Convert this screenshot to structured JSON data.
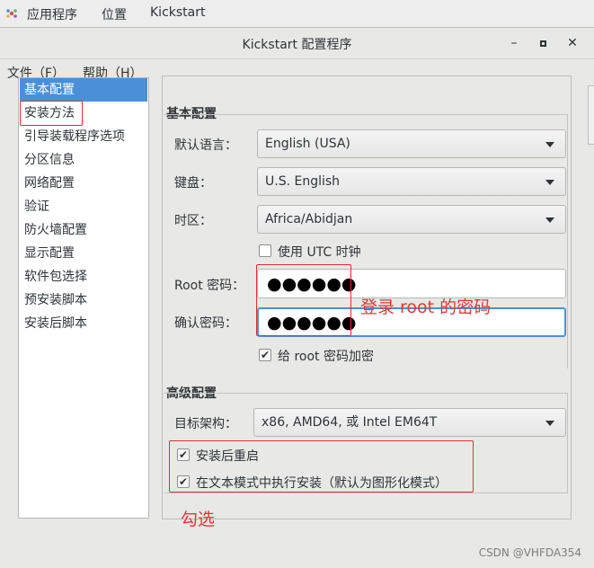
{
  "topbar": {
    "apps": "应用程序",
    "places": "位置",
    "app_name": "Kickstart"
  },
  "window": {
    "title": "Kickstart 配置程序",
    "menu": {
      "file": "文件（F）",
      "help": "帮助（H）"
    }
  },
  "nav": {
    "items": [
      "基本配置",
      "安装方法",
      "引导装载程序选项",
      "分区信息",
      "网络配置",
      "验证",
      "防火墙配置",
      "显示配置",
      "软件包选择",
      "预安装脚本",
      "安装后脚本"
    ],
    "selected_index": 0
  },
  "basic": {
    "title": "基本配置",
    "language_label": "默认语言：",
    "language_value": "English (USA)",
    "keyboard_label": "键盘：",
    "keyboard_value": "U.S. English",
    "timezone_label": "时区：",
    "timezone_value": "Africa/Abidjan",
    "utc_label": "使用  UTC 时钟",
    "utc_checked": false,
    "root_pw_label": "Root 密码：",
    "root_pw_mask": "●●●●●●",
    "confirm_pw_label": "确认密码：",
    "confirm_pw_mask": "●●●●●●",
    "encrypt_label": "给  root 密码加密",
    "encrypt_checked": true
  },
  "advanced": {
    "title": "高级配置",
    "arch_label": "目标架构：",
    "arch_value": "x86, AMD64, 或  Intel EM64T",
    "reboot_label": "安装后重启",
    "reboot_checked": true,
    "textmode_label": "在文本模式中执行安装（默认为图形化模式）",
    "textmode_checked": true
  },
  "annotations": {
    "password_note": "登录 root 的密码",
    "check_note": "勾选",
    "color": "#e53935"
  },
  "watermark": "CSDN @VHFDA354"
}
